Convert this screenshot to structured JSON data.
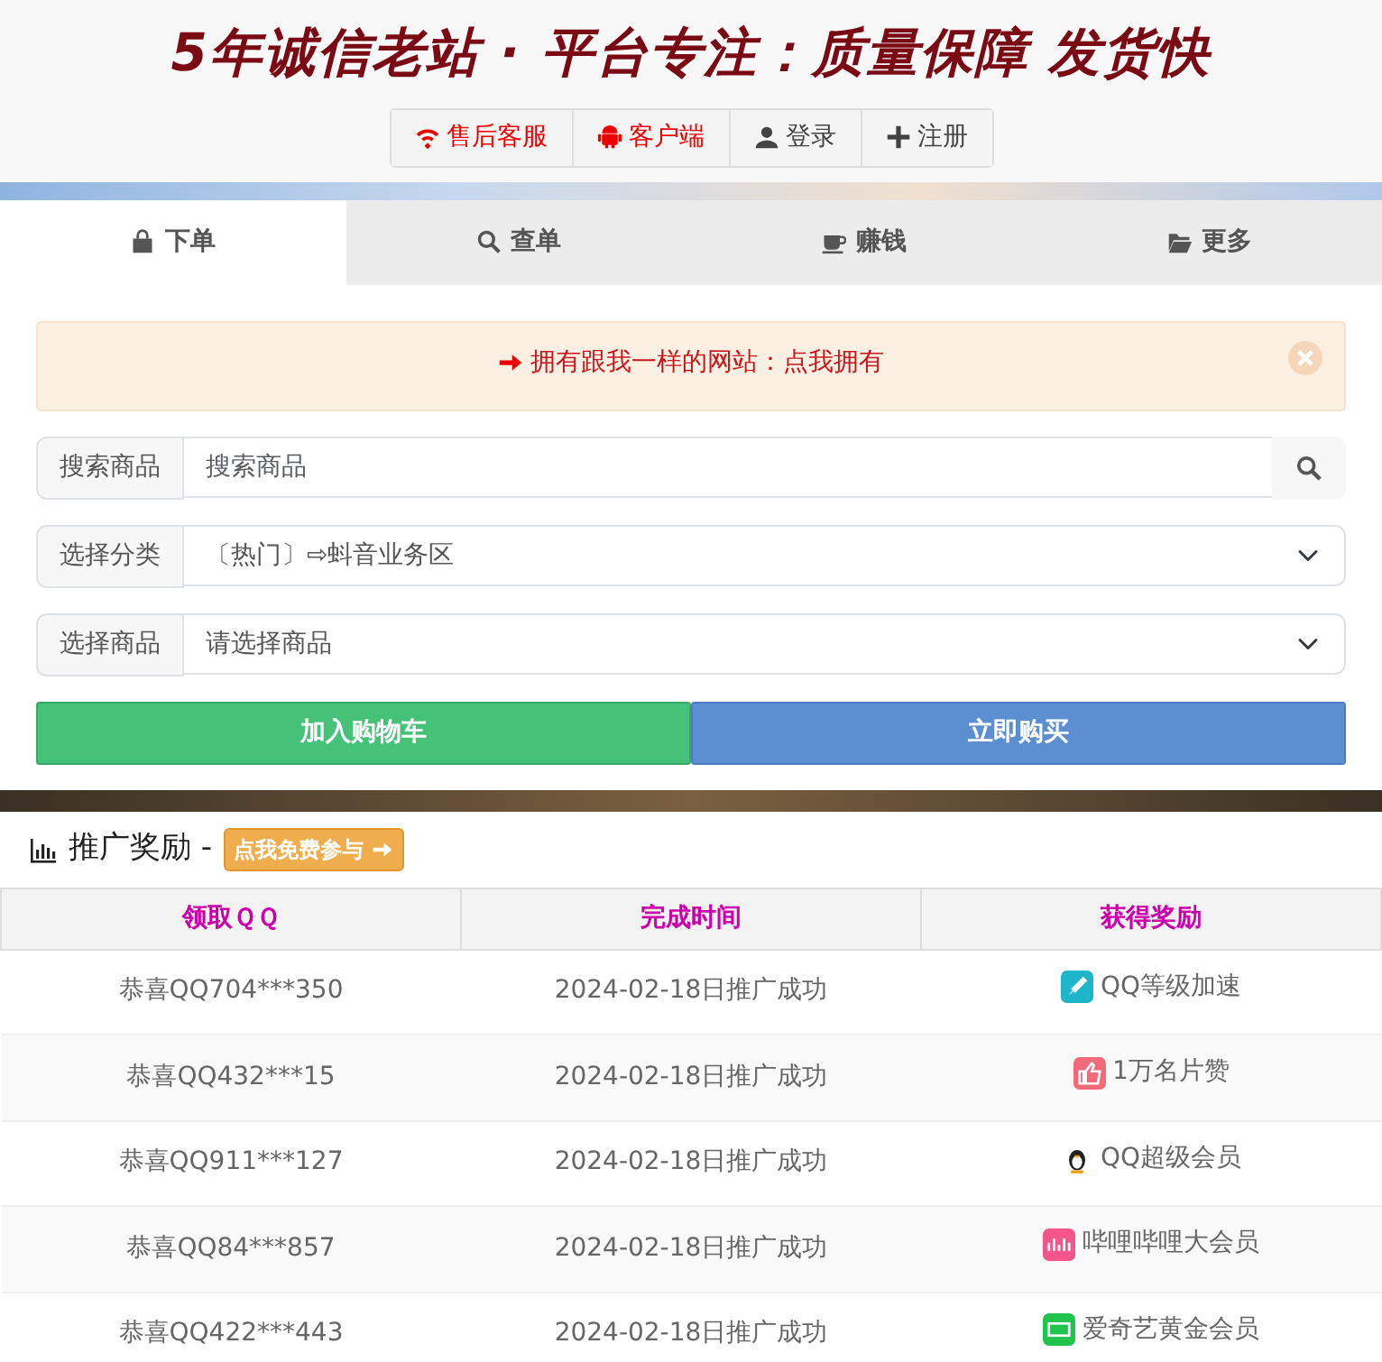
{
  "banner": {
    "title": "5年诚信老站 · 平台专注：质量保障 发货快"
  },
  "top_buttons": [
    {
      "label": "售后客服",
      "highlight": true
    },
    {
      "label": "客户端",
      "highlight": true
    },
    {
      "label": "登录",
      "highlight": false
    },
    {
      "label": "注册",
      "highlight": false
    }
  ],
  "tabs": [
    {
      "label": "下单",
      "selected": true
    },
    {
      "label": "查单",
      "selected": false
    },
    {
      "label": "赚钱",
      "selected": false
    },
    {
      "label": "更多",
      "selected": false
    }
  ],
  "notice": {
    "text": "拥有跟我一样的网站：点我拥有"
  },
  "search": {
    "label": "搜索商品",
    "placeholder": "搜索商品"
  },
  "category": {
    "label": "选择分类",
    "value": "〔热门〕⇨蚪音业务区"
  },
  "product": {
    "label": "选择商品",
    "value": "请选择商品"
  },
  "buttons": [
    {
      "label": "加入购物车",
      "kind": "cart"
    },
    {
      "label": "立即购买",
      "kind": "buy"
    }
  ],
  "rewards": {
    "title": "推广奖励 -",
    "join_badge": "点我免费参与",
    "columns": [
      "领取ＱＱ",
      "完成时间",
      "获得奖励"
    ],
    "rows": [
      {
        "qq": "恭喜QQ704***350",
        "time": "2024-02-18日推广成功",
        "reward": "QQ等级加速",
        "kind": "rocket",
        "color": "#1cb5c9"
      },
      {
        "qq": "恭喜QQ432***15",
        "time": "2024-02-18日推广成功",
        "reward": "1万名片赞",
        "kind": "thumb",
        "color": "#f06a7a"
      },
      {
        "qq": "恭喜QQ911***127",
        "time": "2024-02-18日推广成功",
        "reward": "QQ超级会员",
        "kind": "penguin"
      },
      {
        "qq": "恭喜QQ84***857",
        "time": "2024-02-18日推广成功",
        "reward": "哔哩哔哩大会员",
        "kind": "bars",
        "color": "#f2568a"
      },
      {
        "qq": "恭喜QQ422***443",
        "time": "2024-02-18日推广成功",
        "reward": "爱奇艺黄金会员",
        "kind": "tv",
        "color": "#1fc34e"
      }
    ]
  }
}
